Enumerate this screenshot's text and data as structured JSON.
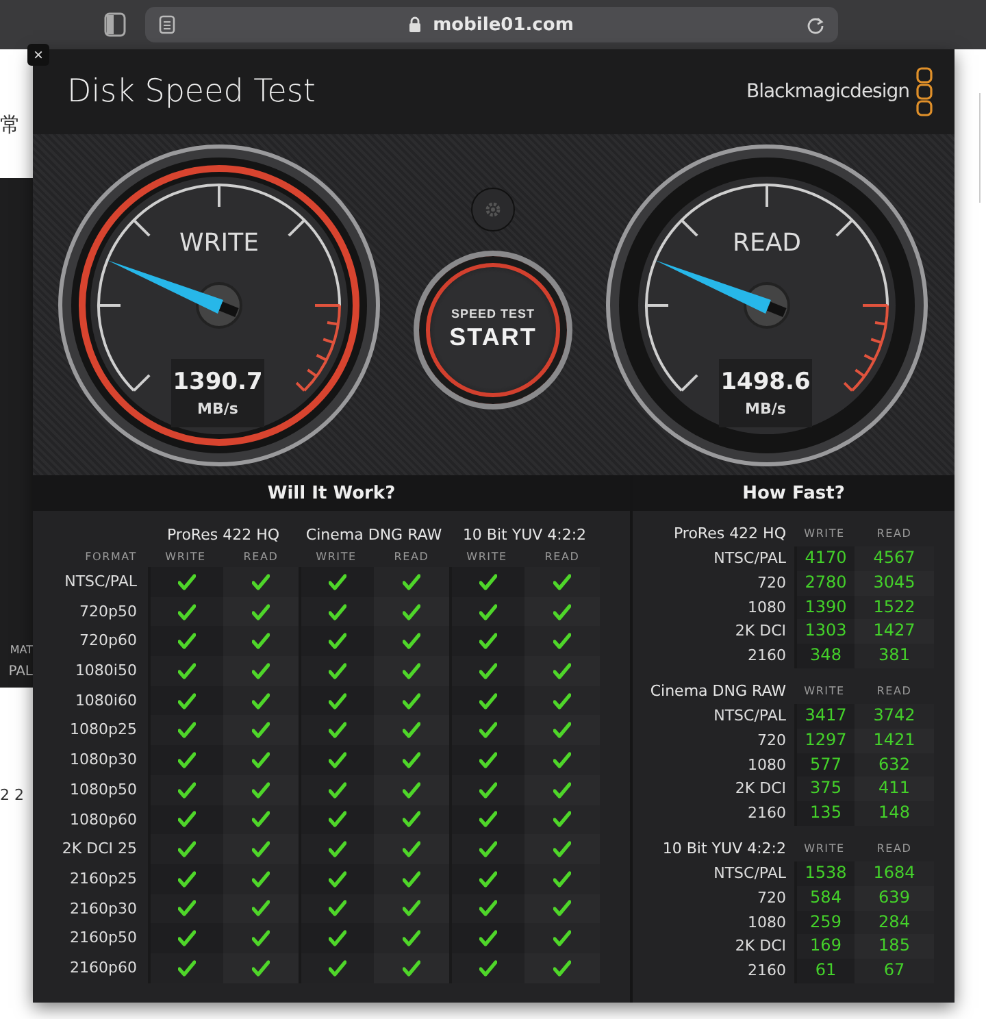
{
  "browser": {
    "address": "mobile01.com"
  },
  "background_page": {
    "texts": [
      "常",
      "MAT",
      "PAL",
      "2 2"
    ]
  },
  "window": {
    "title": "Disk Speed Test",
    "brand": "Blackmagicdesign",
    "close": "×"
  },
  "gauges": [
    {
      "label": "WRITE",
      "value": "1390.7",
      "unit": "MB/s",
      "highlighted": true
    },
    {
      "label": "READ",
      "value": "1498.6",
      "unit": "MB/s",
      "highlighted": false
    }
  ],
  "start_button": {
    "caption": "SPEED TEST",
    "label": "START"
  },
  "will_it_work": {
    "title": "Will It Work?",
    "format_label": "FORMAT",
    "columns": [
      {
        "title": "ProRes 422 HQ",
        "write_label": "WRITE",
        "read_label": "READ"
      },
      {
        "title": "Cinema DNG RAW",
        "write_label": "WRITE",
        "read_label": "READ"
      },
      {
        "title": "10 Bit YUV 4:2:2",
        "write_label": "WRITE",
        "read_label": "READ"
      }
    ],
    "rows": [
      {
        "format": "NTSC/PAL",
        "checks": [
          true,
          true,
          true,
          true,
          true,
          true
        ]
      },
      {
        "format": "720p50",
        "checks": [
          true,
          true,
          true,
          true,
          true,
          true
        ]
      },
      {
        "format": "720p60",
        "checks": [
          true,
          true,
          true,
          true,
          true,
          true
        ]
      },
      {
        "format": "1080i50",
        "checks": [
          true,
          true,
          true,
          true,
          true,
          true
        ]
      },
      {
        "format": "1080i60",
        "checks": [
          true,
          true,
          true,
          true,
          true,
          true
        ]
      },
      {
        "format": "1080p25",
        "checks": [
          true,
          true,
          true,
          true,
          true,
          true
        ]
      },
      {
        "format": "1080p30",
        "checks": [
          true,
          true,
          true,
          true,
          true,
          true
        ]
      },
      {
        "format": "1080p50",
        "checks": [
          true,
          true,
          true,
          true,
          true,
          true
        ]
      },
      {
        "format": "1080p60",
        "checks": [
          true,
          true,
          true,
          true,
          true,
          true
        ]
      },
      {
        "format": "2K DCI 25",
        "checks": [
          true,
          true,
          true,
          true,
          true,
          true
        ]
      },
      {
        "format": "2160p25",
        "checks": [
          true,
          true,
          true,
          true,
          true,
          true
        ]
      },
      {
        "format": "2160p30",
        "checks": [
          true,
          true,
          true,
          true,
          true,
          true
        ]
      },
      {
        "format": "2160p50",
        "checks": [
          true,
          true,
          true,
          true,
          true,
          true
        ]
      },
      {
        "format": "2160p60",
        "checks": [
          true,
          true,
          true,
          true,
          true,
          true
        ]
      }
    ]
  },
  "how_fast": {
    "title": "How Fast?",
    "groups": [
      {
        "title": "ProRes 422 HQ",
        "write_label": "WRITE",
        "read_label": "READ",
        "rows": [
          {
            "format": "NTSC/PAL",
            "write": "4170",
            "read": "4567"
          },
          {
            "format": "720",
            "write": "2780",
            "read": "3045"
          },
          {
            "format": "1080",
            "write": "1390",
            "read": "1522"
          },
          {
            "format": "2K DCI",
            "write": "1303",
            "read": "1427"
          },
          {
            "format": "2160",
            "write": "348",
            "read": "381"
          }
        ]
      },
      {
        "title": "Cinema DNG RAW",
        "write_label": "WRITE",
        "read_label": "READ",
        "rows": [
          {
            "format": "NTSC/PAL",
            "write": "3417",
            "read": "3742"
          },
          {
            "format": "720",
            "write": "1297",
            "read": "1421"
          },
          {
            "format": "1080",
            "write": "577",
            "read": "632"
          },
          {
            "format": "2K DCI",
            "write": "375",
            "read": "411"
          },
          {
            "format": "2160",
            "write": "135",
            "read": "148"
          }
        ]
      },
      {
        "title": "10 Bit YUV 4:2:2",
        "write_label": "WRITE",
        "read_label": "READ",
        "rows": [
          {
            "format": "NTSC/PAL",
            "write": "1538",
            "read": "1684"
          },
          {
            "format": "720",
            "write": "584",
            "read": "639"
          },
          {
            "format": "1080",
            "write": "259",
            "read": "284"
          },
          {
            "format": "2K DCI",
            "write": "169",
            "read": "185"
          },
          {
            "format": "2160",
            "write": "61",
            "read": "67"
          }
        ]
      }
    ]
  }
}
